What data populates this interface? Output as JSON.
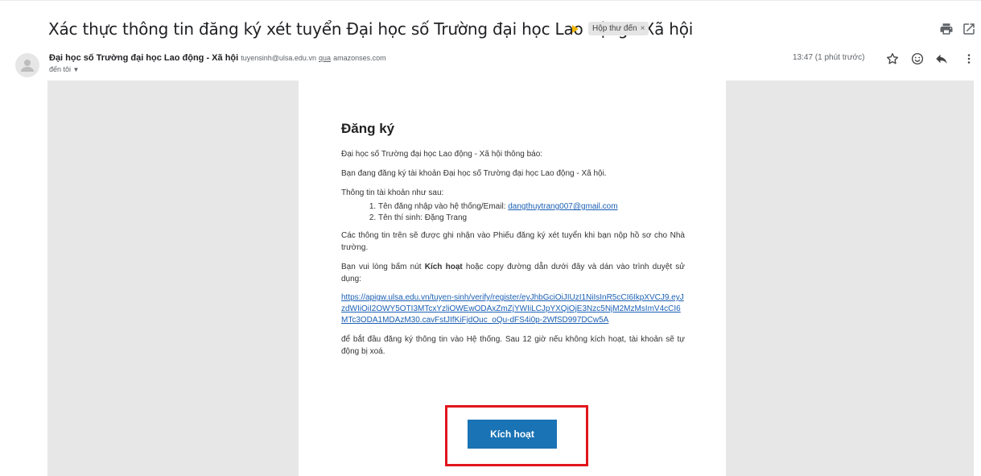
{
  "email": {
    "subject": "Xác thực thông tin đăng ký xét tuyển Đại học số Trường đại học Lao động - Xã hội",
    "label_chip": "Hộp thư đến",
    "label_chip_close": "×",
    "sender_name": "Đại học số Trường đại học Lao động - Xã hội",
    "sender_email": "tuyensinh@ulsa.edu.vn",
    "via_word": "qua",
    "via_domain": "amazonses.com",
    "to_label": "đến tôi",
    "timestamp": "13:47 (1 phút trước)"
  },
  "icons": {
    "print": "print-icon",
    "open_new_window": "open-in-new-window-icon",
    "star": "star-icon",
    "emoji": "emoji-reaction-icon",
    "reply": "reply-icon",
    "more": "more-vert-icon",
    "avatar": "default-avatar-icon",
    "important": "importance-marker-icon",
    "dropdown": "chevron-down-icon"
  },
  "body": {
    "title": "Đăng ký",
    "notice": "Đại học số Trường đại học Lao động - Xã hội thông báo:",
    "registering": "Bạn đang đăng ký tài khoản Đại học số Trường đại học Lao động - Xã hội.",
    "account_info": "Thông tin tài khoản như sau:",
    "item1_label": "Tên đăng nhập vào hệ thống/Email: ",
    "item1_email": "dangthuytrang007@gmail.com",
    "item2": "Tên thí sinh: Đặng Trang",
    "record_note": "Các thông tin trên sẽ được ghi nhận vào Phiếu đăng ký xét tuyển khi bạn nộp hồ sơ cho Nhà trường.",
    "instruction_pre": "Bạn vui lòng bấm nút ",
    "instruction_bold": "Kích hoạt",
    "instruction_post": " hoặc copy đường dẫn dưới đây và dán vào trình duyệt sử dụng:",
    "verify_url": "https://apigw.ulsa.edu.vn/tuyen-sinh/verify/register/eyJhbGciOiJIUzI1NiIsInR5cCI6IkpXVCJ9.eyJzdWIiOiI2OWY5OTI3MTcxYzliOWEwODAxZmZjYWIiLCJpYXQiOjE3Nzc5NjM2MzMsImV4cCI6MTc3ODA1MDAzM30.cavFstJIfKiFjdOuc_oQu-dFS4i0p-2WfSD997DCw5A",
    "deadline_note": "để bắt đầu đăng ký thông tin vào Hệ thống. Sau 12 giờ nếu không kích hoạt, tài khoản sẽ tự động bị xoá.",
    "cta_label": "Kích hoạt"
  },
  "colors": {
    "cta_bg": "#1a73b5",
    "highlight_border": "#e0161c",
    "link": "#1a5fb4",
    "important_marker": "#f2b600",
    "frame_bg": "#e7e7e7"
  }
}
